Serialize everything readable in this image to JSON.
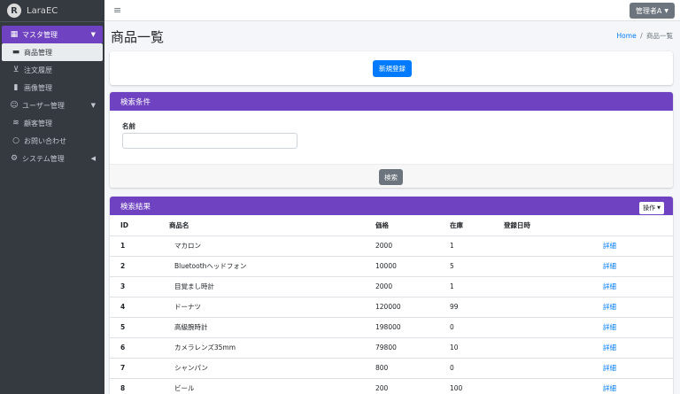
{
  "brand": {
    "logo_letter": "R",
    "name": "LaraEC"
  },
  "sidebar": {
    "items": [
      {
        "label": "マスタ管理",
        "icon": "grid-icon"
      },
      {
        "label": "商品管理",
        "icon": "cube-icon"
      },
      {
        "label": "注文履歴",
        "icon": "cart-icon"
      },
      {
        "label": "画像管理",
        "icon": "file-icon"
      },
      {
        "label": "ユーザー管理",
        "icon": "user-circle-icon"
      },
      {
        "label": "顧客管理",
        "icon": "layers-icon"
      },
      {
        "label": "お問い合わせ",
        "icon": "chat-icon"
      },
      {
        "label": "システム管理",
        "icon": "cogs-icon"
      }
    ]
  },
  "topbar": {
    "user_label": "管理者A"
  },
  "header": {
    "title": "商品一覧",
    "breadcrumb": {
      "home": "Home",
      "separator": "/",
      "current": "商品一覧"
    }
  },
  "actions": {
    "new_label": "新規登録"
  },
  "search": {
    "title": "検索条件",
    "name_label": "名前",
    "name_value": "",
    "submit_label": "検索"
  },
  "results": {
    "title": "検索結果",
    "ops_label": "操作",
    "columns": {
      "id": "ID",
      "name": "商品名",
      "price": "価格",
      "stock": "在庫",
      "date": "登録日時"
    },
    "detail_label": "詳細",
    "rows": [
      {
        "id": "1",
        "name": "マカロン",
        "price": "2000",
        "stock": "1",
        "date": ""
      },
      {
        "id": "2",
        "name": "Bluetoothヘッドフォン",
        "price": "10000",
        "stock": "5",
        "date": ""
      },
      {
        "id": "3",
        "name": "目覚まし時計",
        "price": "2000",
        "stock": "1",
        "date": ""
      },
      {
        "id": "4",
        "name": "ドーナツ",
        "price": "120000",
        "stock": "99",
        "date": ""
      },
      {
        "id": "5",
        "name": "高級腕時計",
        "price": "198000",
        "stock": "0",
        "date": ""
      },
      {
        "id": "6",
        "name": "カメラレンズ35mm",
        "price": "79800",
        "stock": "10",
        "date": ""
      },
      {
        "id": "7",
        "name": "シャンパン",
        "price": "800",
        "stock": "0",
        "date": ""
      },
      {
        "id": "8",
        "name": "ビール",
        "price": "200",
        "stock": "100",
        "date": ""
      }
    ]
  },
  "colors": {
    "accent": "#6f42c1",
    "primary": "#007bff",
    "sidebar_bg": "#343a40",
    "secondary": "#6c757d"
  }
}
